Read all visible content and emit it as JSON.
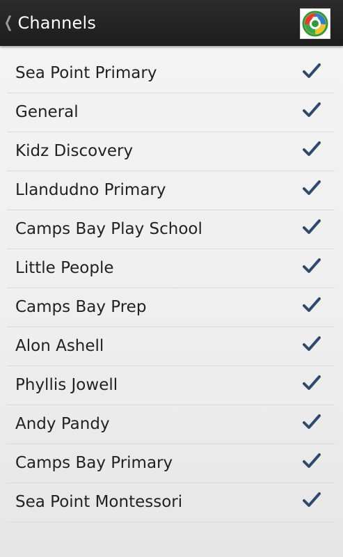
{
  "header": {
    "title": "Channels",
    "back_icon": "chevron-left-icon",
    "logo_icon": "school-logo-icon"
  },
  "colors": {
    "action_bar": "#222222",
    "checkmark": "#2e4a6e",
    "row_text": "#222222"
  },
  "channels": [
    {
      "name": "Sea Point Primary",
      "checked": true
    },
    {
      "name": "General",
      "checked": true
    },
    {
      "name": "Kidz Discovery",
      "checked": true
    },
    {
      "name": "Llandudno Primary",
      "checked": true
    },
    {
      "name": "Camps Bay Play School",
      "checked": true
    },
    {
      "name": "Little People",
      "checked": true
    },
    {
      "name": "Camps Bay Prep",
      "checked": true
    },
    {
      "name": "Alon Ashell",
      "checked": true
    },
    {
      "name": "Phyllis Jowell",
      "checked": true
    },
    {
      "name": "Andy Pandy",
      "checked": true
    },
    {
      "name": "Camps Bay Primary",
      "checked": true
    },
    {
      "name": "Sea Point Montessori",
      "checked": true
    }
  ]
}
